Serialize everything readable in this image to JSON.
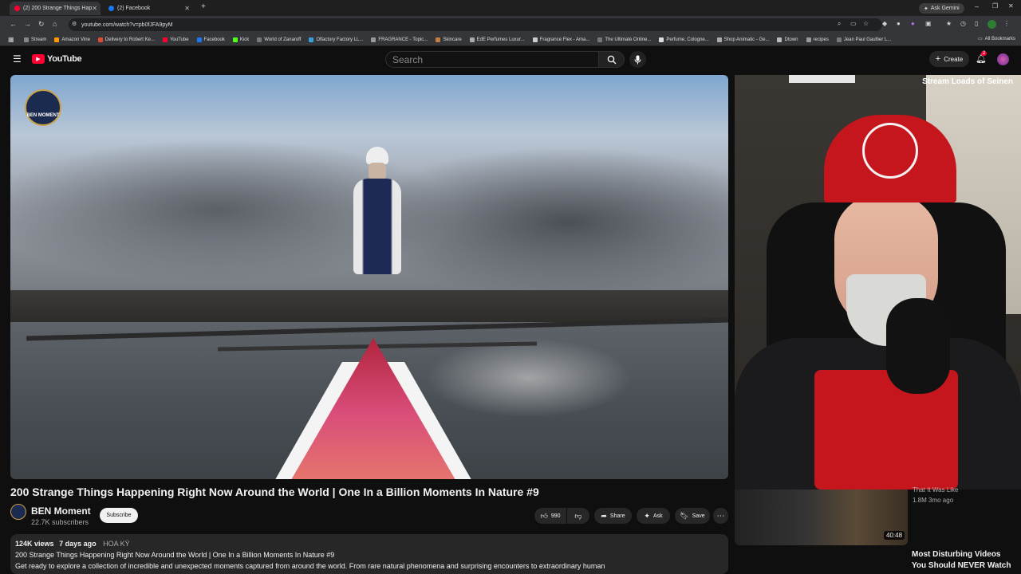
{
  "browser": {
    "tabs": [
      {
        "label": "(2) 200 Strange Things Hap",
        "favicon_color": "#ff0033"
      },
      {
        "label": "(2) Facebook",
        "favicon_color": "#1877f2"
      }
    ],
    "new_tab": "+",
    "ask_gemini": "Ask Gemini",
    "url": "youtube.com/watch?v=pb0fJFA9pyM",
    "bookmarks": [
      "Stream",
      "Amazon Vine",
      "Delivery to Robert Ke...",
      "YouTube",
      "Facebook",
      "Kick",
      "World of Zanaroff",
      "Olfactory Factory LL...",
      "FRAGRANCE - Topic...",
      "Skincare",
      "EdE Perfumes Luxur...",
      "Fragrance Flex - Ama...",
      "The Ultimate Online...",
      "Perfume, Cologne...",
      "Shop Animatic - Ge...",
      "Dtown",
      "recipes",
      "Jean Paul Gaultier L..."
    ],
    "all_bookmarks": "All Bookmarks"
  },
  "youtube": {
    "logo_text": "YouTube",
    "search_placeholder": "Search",
    "create_label": "Create",
    "notif_count": "2"
  },
  "video": {
    "channel_badge": "BEN MOMENT",
    "title": "200 Strange Things Happening Right Now Around the World | One In a Billion Moments In Nature #9",
    "channel": "BEN Moment",
    "subscribers": "22.7K subscribers",
    "subscribe_label": "Subscribe",
    "likes": "990",
    "share_label": "Share",
    "ask_label": "Ask",
    "save_label": "Save",
    "more_label": "⋯",
    "description": {
      "views": "124K views",
      "age": "7 days ago",
      "tag": "HOA KỲ",
      "line1": "200 Strange Things Happening Right Now Around the World | One In a Billion Moments In Nature #9",
      "line2": "Get ready to explore a collection of incredible and unexpected moments captured from around the world. From rare natural phenomena and surprising encounters to extraordinary human"
    }
  },
  "sidebar": {
    "top_title": "Stream Loads of Seinen",
    "related": {
      "partial_title": "That It Was Like",
      "meta": "1.8M  3mo ago",
      "duration": "40:48",
      "title_line1": "Most Disturbing Videos",
      "title_line2": "You Should NEVER Watch"
    }
  },
  "colors": {
    "brand_red": "#ff0033",
    "bg": "#0f0f0f",
    "pill": "#272727"
  }
}
